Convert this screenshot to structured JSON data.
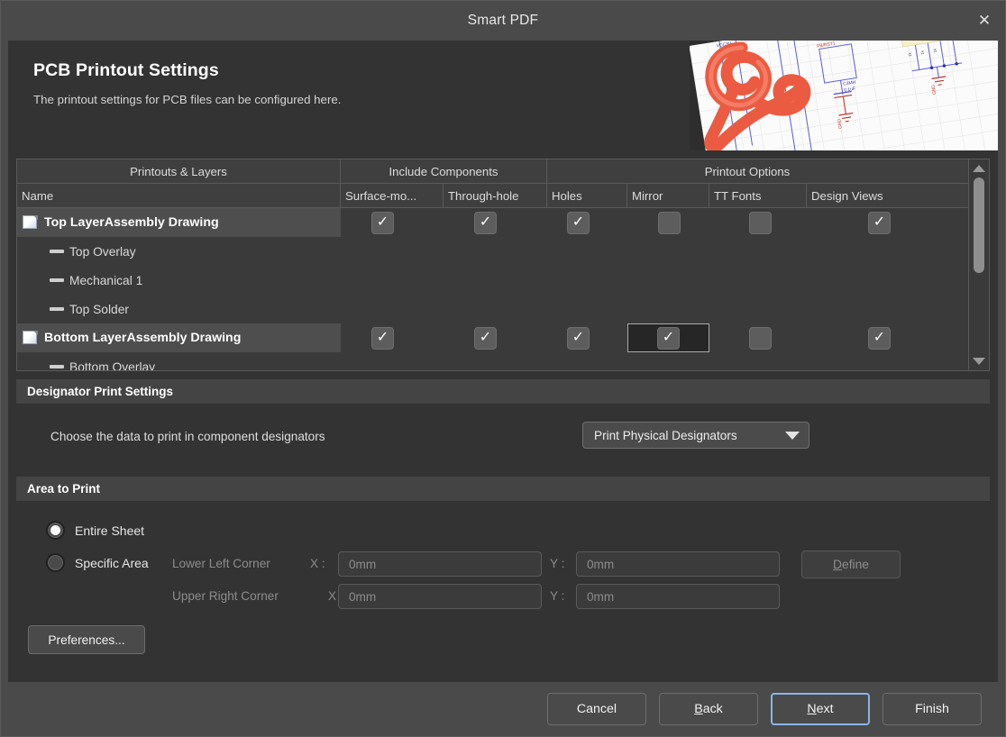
{
  "window": {
    "title": "Smart PDF",
    "close_icon": "close-icon"
  },
  "banner": {
    "title": "PCB Printout Settings",
    "subtitle": "The printout settings for PCB files can be configured here.",
    "art": "acrobat-ribbon-on-schematic"
  },
  "tree": {
    "group_headers": [
      {
        "label": "Printouts & Layers"
      },
      {
        "label": "Include Components"
      },
      {
        "label": "Printout Options"
      }
    ],
    "columns": [
      "Name",
      "Surface-mo...",
      "Through-hole",
      "Holes",
      "Mirror",
      "TT Fonts",
      "Design Views"
    ],
    "rows": [
      {
        "type": "printout",
        "name": "Top LayerAssembly Drawing",
        "icon": "document-icon",
        "checks": [
          true,
          true,
          true,
          false,
          false,
          true
        ],
        "selected_cell": -1
      },
      {
        "type": "layer",
        "name": "Top Overlay",
        "icon": "layer-dash-icon"
      },
      {
        "type": "layer",
        "name": "Mechanical 1",
        "icon": "layer-dash-icon"
      },
      {
        "type": "layer",
        "name": "Top Solder",
        "icon": "layer-dash-icon"
      },
      {
        "type": "printout",
        "name": "Bottom LayerAssembly Drawing",
        "icon": "document-icon",
        "checks": [
          true,
          true,
          true,
          true,
          false,
          true
        ],
        "selected_cell": 3
      },
      {
        "type": "layer",
        "name": "Bottom Overlay",
        "icon": "layer-dash-icon"
      }
    ],
    "scrollbar": {
      "up_icon": "scroll-up-arrow-icon",
      "down_icon": "scroll-down-arrow-icon"
    }
  },
  "designator": {
    "section_title": "Designator Print Settings",
    "label": "Choose the data to print in component designators",
    "dropdown_value": "Print Physical Designators",
    "dropdown_caret_icon": "chevron-down-icon"
  },
  "area": {
    "section_title": "Area to Print",
    "entire_sheet_label": "Entire Sheet",
    "entire_sheet_selected": true,
    "specific_area_label": "Specific Area",
    "specific_area_selected": false,
    "lower_left_label": "Lower Left Corner",
    "upper_right_label": "Upper Right Corner",
    "x_label_1": "X :",
    "x_label_2": "X :",
    "y_label_1": "Y :",
    "y_label_2": "Y :",
    "ll_x_value": "0mm",
    "ll_y_value": "0mm",
    "ur_x_value": "0mm",
    "ur_y_value": "0mm",
    "define_accel": "D",
    "define_rest": "efine"
  },
  "preferences": {
    "label": "Preferences..."
  },
  "footer": {
    "cancel": "Cancel",
    "back_accel": "B",
    "back_rest": "ack",
    "next_accel": "N",
    "next_rest": "ext",
    "finish": "Finish"
  },
  "colors": {
    "titlebar": "#4a4a4a",
    "content": "#333333",
    "section_header": "#444444",
    "focus_blue": "#8ab4e8",
    "acrobat_red": "#eb5b41"
  }
}
